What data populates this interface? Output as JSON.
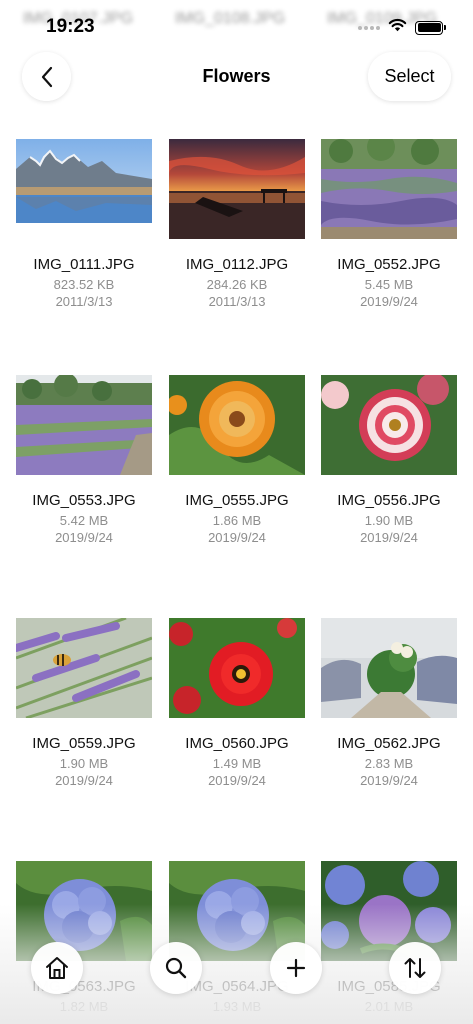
{
  "status_bar": {
    "time": "19:23",
    "signal_icon": "cellular-signal-icon",
    "wifi_icon": "wifi-icon",
    "battery_icon": "battery-icon",
    "battery_level": 1.0
  },
  "ghost_row": {
    "names": [
      "IMG_0107.JPG",
      "IMG_0108.JPG",
      "IMG_0109.JPG"
    ]
  },
  "nav": {
    "back_icon": "chevron-left-icon",
    "title": "Flowers",
    "select_label": "Select"
  },
  "files": [
    {
      "name": "IMG_0111.JPG",
      "size": "823.52 KB",
      "date": "2011/3/13",
      "thumb": "mountain-lake"
    },
    {
      "name": "IMG_0112.JPG",
      "size": "284.26 KB",
      "date": "2011/3/13",
      "thumb": "sunset-pier"
    },
    {
      "name": "IMG_0552.JPG",
      "size": "5.45 MB",
      "date": "2019/9/24",
      "thumb": "lavender-field"
    },
    {
      "name": "IMG_0553.JPG",
      "size": "5.42 MB",
      "date": "2019/9/24",
      "thumb": "lavender-rows"
    },
    {
      "name": "IMG_0555.JPG",
      "size": "1.86 MB",
      "date": "2019/9/24",
      "thumb": "orange-zinnia"
    },
    {
      "name": "IMG_0556.JPG",
      "size": "1.90 MB",
      "date": "2019/9/24",
      "thumb": "pink-zinnia"
    },
    {
      "name": "IMG_0559.JPG",
      "size": "1.90 MB",
      "date": "2019/9/24",
      "thumb": "bee-lavender"
    },
    {
      "name": "IMG_0560.JPG",
      "size": "1.49 MB",
      "date": "2019/9/24",
      "thumb": "red-zinnia"
    },
    {
      "name": "IMG_0562.JPG",
      "size": "2.83 MB",
      "date": "2019/9/24",
      "thumb": "garden-path"
    },
    {
      "name": "IMG_0563.JPG",
      "size": "1.82 MB",
      "date": "",
      "thumb": "hydrangea-blue"
    },
    {
      "name": "IMG_0564.JPG",
      "size": "1.93 MB",
      "date": "",
      "thumb": "hydrangea-blue"
    },
    {
      "name": "IMG_0585.JPG",
      "size": "2.01 MB",
      "date": "",
      "thumb": "hydrangea-bush"
    }
  ],
  "toolbar": {
    "home_icon": "home-icon",
    "search_icon": "search-icon",
    "add_icon": "plus-icon",
    "sort_icon": "sort-arrows-icon"
  }
}
